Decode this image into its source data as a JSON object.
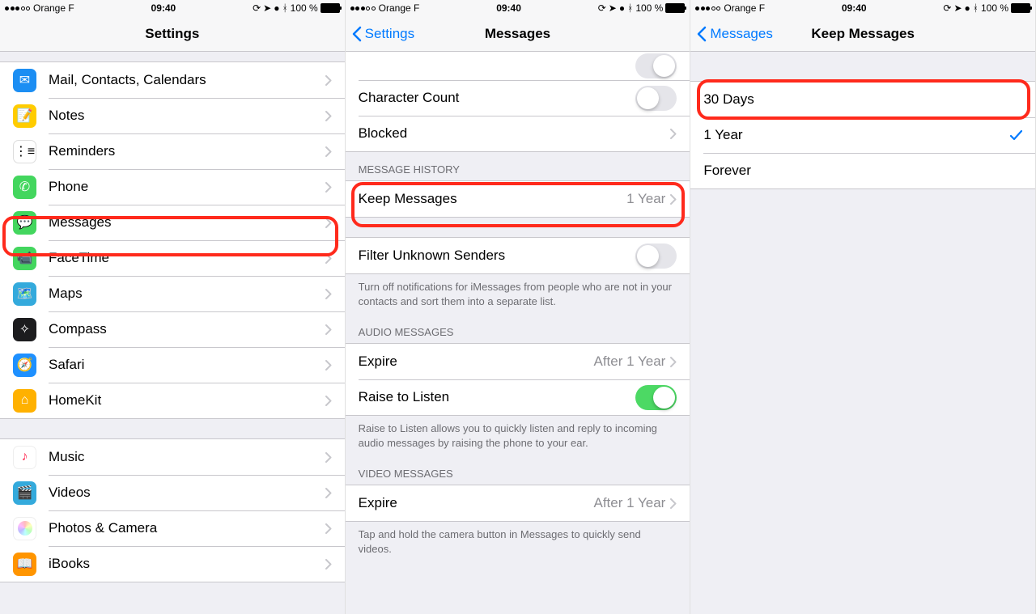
{
  "status": {
    "carrier": "Orange F",
    "time": "09:40",
    "battery_pct": "100 %"
  },
  "panel1": {
    "title": "Settings",
    "rows": {
      "mail": "Mail, Contacts, Calendars",
      "notes": "Notes",
      "reminders": "Reminders",
      "phone": "Phone",
      "messages": "Messages",
      "facetime": "FaceTime",
      "maps": "Maps",
      "compass": "Compass",
      "safari": "Safari",
      "homekit": "HomeKit",
      "music": "Music",
      "videos": "Videos",
      "photos": "Photos & Camera",
      "ibooks": "iBooks"
    }
  },
  "panel2": {
    "back": "Settings",
    "title": "Messages",
    "rows": {
      "char_count": "Character Count",
      "blocked": "Blocked",
      "section_history": "MESSAGE HISTORY",
      "keep_messages": "Keep Messages",
      "keep_messages_value": "1 Year",
      "filter_unknown": "Filter Unknown Senders",
      "filter_footer": "Turn off notifications for iMessages from people who are not in your contacts and sort them into a separate list.",
      "section_audio": "AUDIO MESSAGES",
      "audio_expire": "Expire",
      "audio_expire_value": "After 1 Year",
      "raise_listen": "Raise to Listen",
      "raise_footer": "Raise to Listen allows you to quickly listen and reply to incoming audio messages by raising the phone to your ear.",
      "section_video": "VIDEO MESSAGES",
      "video_expire": "Expire",
      "video_expire_value": "After 1 Year",
      "video_footer": "Tap and hold the camera button in Messages to quickly send videos."
    }
  },
  "panel3": {
    "back": "Messages",
    "title": "Keep Messages",
    "options": {
      "d30": "30 Days",
      "y1": "1 Year",
      "forever": "Forever"
    }
  }
}
